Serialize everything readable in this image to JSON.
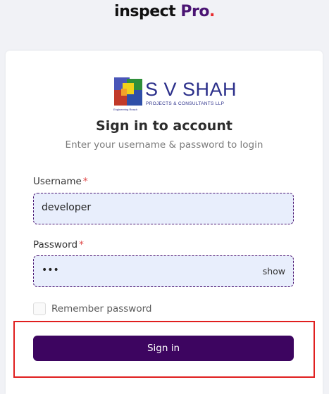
{
  "brand": {
    "name": "inspect",
    "pro": "Pro",
    "dot": "."
  },
  "logo": {
    "company": "S V SHAH",
    "subtitle": "PROJECTS & CONSULTANTS LLP",
    "tagline": "Engineering Reach"
  },
  "login": {
    "title": "Sign in to account",
    "subtitle": "Enter your username & password to login",
    "username_label": "Username",
    "username_value": "developer",
    "password_label": "Password",
    "password_value": "•••",
    "show_label": "show",
    "required_mark": "*",
    "remember_label": "Remember password",
    "remember_checked": false,
    "signin_label": "Sign in"
  },
  "colors": {
    "accent": "#3d0560",
    "field_bg": "#e8eefc",
    "required": "#e04848",
    "highlight": "#e01f1f"
  }
}
